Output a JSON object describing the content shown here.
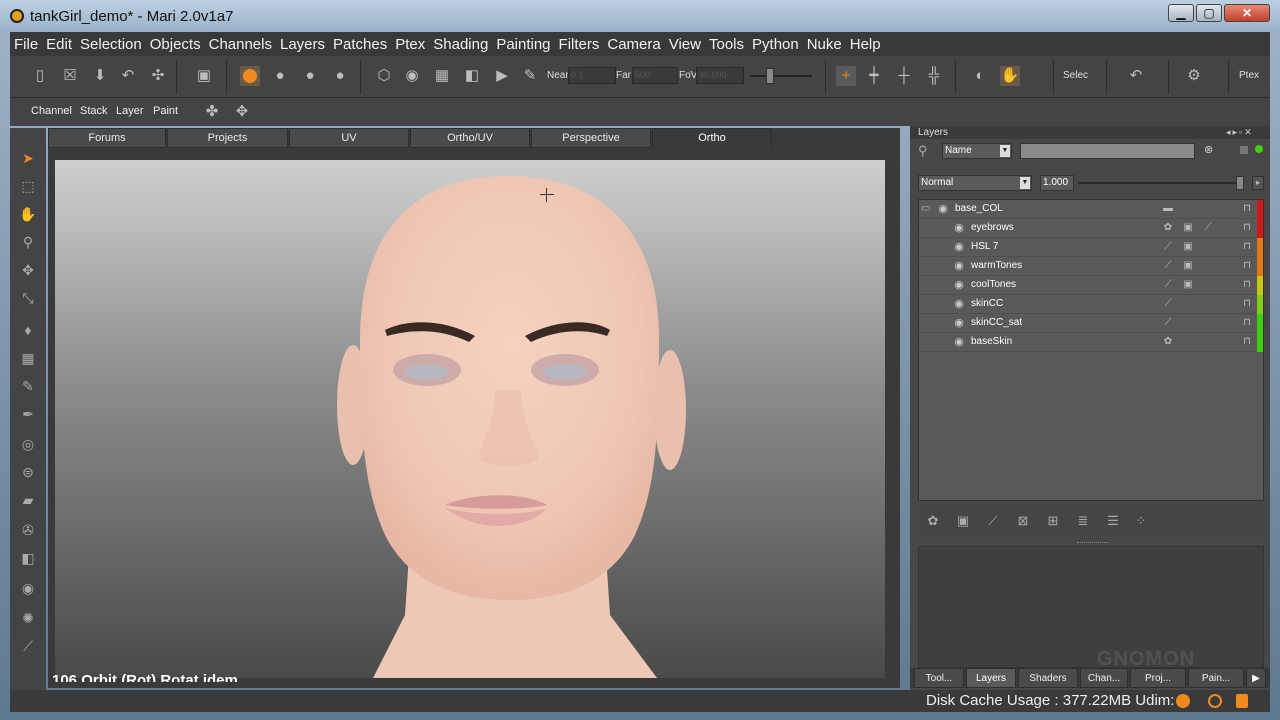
{
  "window": {
    "title": "tankGirl_demo* - Mari 2.0v1a7",
    "minimize": "▁",
    "maximize": "▢",
    "close": "✕"
  },
  "menu": [
    "File",
    "Edit",
    "Selection",
    "Objects",
    "Channels",
    "Layers",
    "Patches",
    "Ptex",
    "Shading",
    "Painting",
    "Filters",
    "Camera",
    "View",
    "Tools",
    "Python",
    "Nuke",
    "Help"
  ],
  "toolbar": {
    "near_label": "Near",
    "near_value": "0.1",
    "far_label": "Far",
    "far_value": "500",
    "fov_label": "FoV",
    "fov_value": "40.000",
    "select_label": "Selec",
    "ptex_label": "Ptex"
  },
  "palette_bar": {
    "tabs": [
      "Channel",
      "Stack",
      "Layer",
      "Paint"
    ]
  },
  "view_tabs": [
    "Forums",
    "Projects",
    "UV",
    "Ortho/UV",
    "Perspective",
    "Ortho"
  ],
  "active_view_tab": "Ortho",
  "viewport_overlay": "106 Orbit (Rot) Rotat idem",
  "layers_panel": {
    "title": "Layers",
    "search_mode": "Name",
    "search_value": "",
    "blend_mode": "Normal",
    "opacity": "1.000",
    "layers": [
      {
        "name": "base_COL",
        "group": true,
        "color": "#d01818"
      },
      {
        "name": "eyebrows",
        "group": false,
        "color": "#d01818"
      },
      {
        "name": "HSL 7",
        "group": false,
        "color": "#e07a10"
      },
      {
        "name": "warmTones",
        "group": false,
        "color": "#e07a10"
      },
      {
        "name": "coolTones",
        "group": false,
        "color": "#c8c810"
      },
      {
        "name": "skinCC",
        "group": false,
        "color": "#7ed010"
      },
      {
        "name": "skinCC_sat",
        "group": false,
        "color": "#3cd010"
      },
      {
        "name": "baseSkin",
        "group": false,
        "color": "#3cd010"
      }
    ]
  },
  "bottom_tabs": [
    "Tool...",
    "Layers",
    "Shaders",
    "Chan...",
    "Proj...",
    "Pain..."
  ],
  "active_bottom_tab": "Layers",
  "status": {
    "disk_cache": "Disk Cache Usage : 377.22MB Udim:"
  },
  "watermark": "GNOMON"
}
